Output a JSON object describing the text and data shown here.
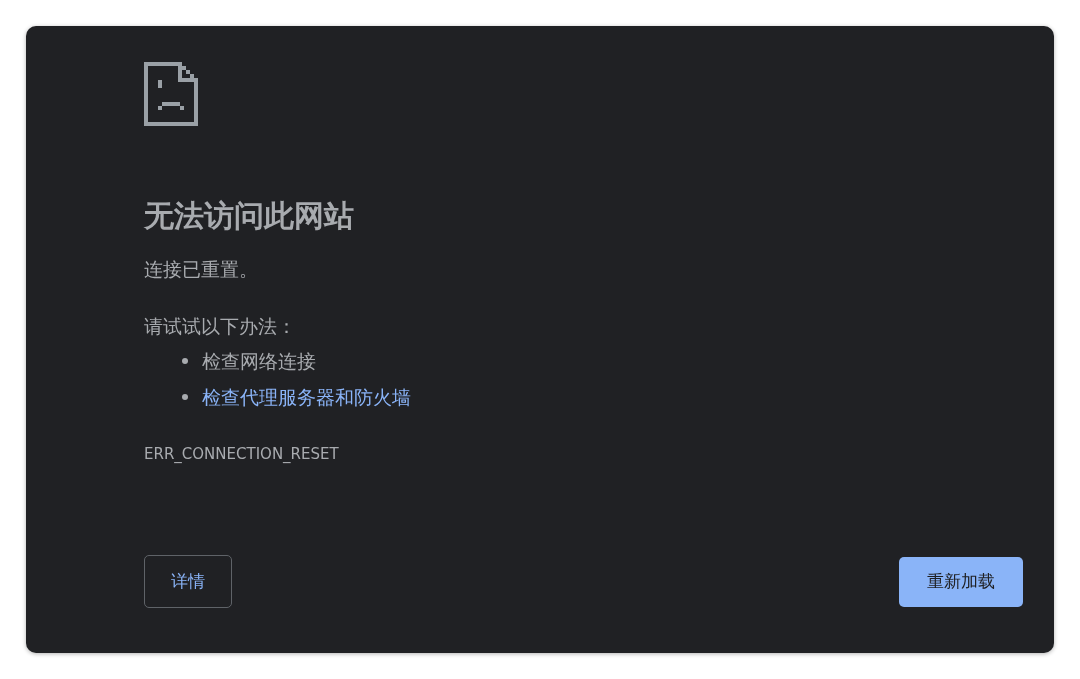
{
  "title": "无法访问此网站",
  "message": "连接已重置。",
  "suggestions_heading": "请试试以下办法：",
  "suggestions": [
    {
      "text": "检查网络连接",
      "kind": "text"
    },
    {
      "text": "检查代理服务器和防火墙",
      "kind": "link"
    }
  ],
  "error_code": "ERR_CONNECTION_RESET",
  "buttons": [
    {
      "label": "详情",
      "kind": "secondary"
    },
    {
      "label": "重新加载",
      "kind": "primary"
    }
  ]
}
